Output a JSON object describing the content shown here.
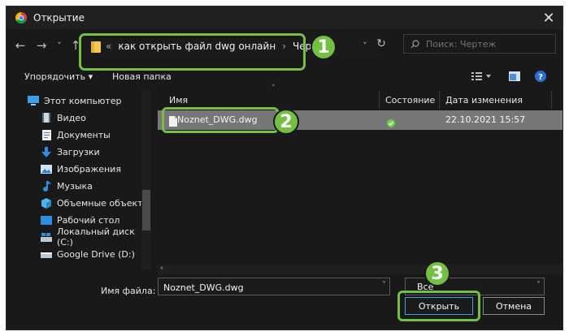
{
  "window": {
    "title": "Открытие",
    "close_symbol": "✕"
  },
  "nav": {
    "back_symbol": "←",
    "forward_symbol": "→",
    "dropdown_symbol": "˅",
    "up_symbol": "↑",
    "lead_symbol": "«",
    "breadcrumb": [
      "как открыть файл dwg онлайн",
      "Чертеж"
    ],
    "breadcrumb_sep": "›",
    "refresh_symbol": "↻",
    "search_placeholder": "Поиск: Чертеж"
  },
  "toolbar": {
    "organize": "Упорядочить ▾",
    "new_folder": "Новая папка"
  },
  "sidebar": {
    "items": [
      {
        "label": "Этот компьютер",
        "icon": "computer-icon"
      },
      {
        "label": "Видео",
        "icon": "video-icon"
      },
      {
        "label": "Документы",
        "icon": "documents-icon"
      },
      {
        "label": "Загрузки",
        "icon": "downloads-icon"
      },
      {
        "label": "Изображения",
        "icon": "images-icon"
      },
      {
        "label": "Музыка",
        "icon": "music-icon"
      },
      {
        "label": "Объемные объекты",
        "icon": "3d-objects-icon"
      },
      {
        "label": "Рабочий стол",
        "icon": "desktop-icon"
      },
      {
        "label": "Локальный диск (C:)",
        "icon": "local-disk-icon"
      },
      {
        "label": "Google Drive (D:)",
        "icon": "drive-icon"
      }
    ]
  },
  "columns": {
    "name": "Имя",
    "status": "Состояние",
    "modified": "Дата изменения"
  },
  "files": [
    {
      "name": "Noznet_DWG.dwg",
      "status": "synced",
      "modified": "22.10.2021 15:57"
    }
  ],
  "footer": {
    "filename_label": "Имя файла:",
    "filename_value": "Noznet_DWG.dwg",
    "filetype_value": "Все",
    "open_label": "Открыть",
    "cancel_label": "Отмена"
  },
  "annotations": [
    "1",
    "2",
    "3"
  ],
  "colors": {
    "accent_green": "#74c043",
    "window_bg": "#191919",
    "selected_row": "#777777"
  }
}
